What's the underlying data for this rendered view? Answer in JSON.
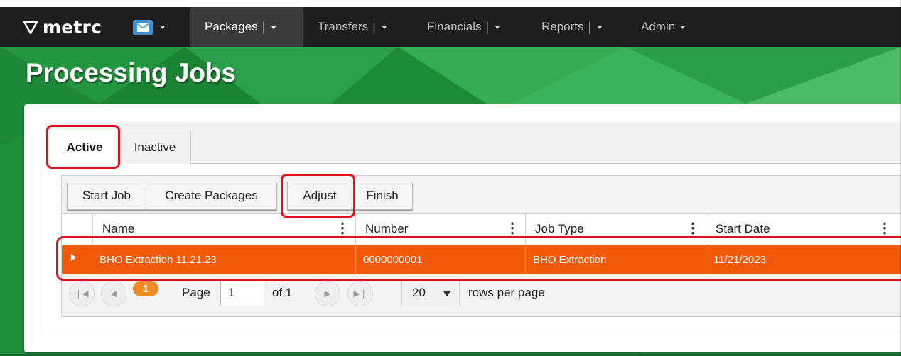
{
  "app": {
    "logo_text": "metrc"
  },
  "nav": {
    "items": [
      {
        "label": "Packages",
        "active": true
      },
      {
        "label": "Transfers",
        "active": false
      },
      {
        "label": "Financials",
        "active": false
      },
      {
        "label": "Reports",
        "active": false
      },
      {
        "label": "Admin",
        "active": false
      }
    ]
  },
  "page": {
    "title": "Processing Jobs"
  },
  "tabs": [
    {
      "label": "Active",
      "selected": true
    },
    {
      "label": "Inactive",
      "selected": false
    }
  ],
  "toolbar": {
    "start_job": "Start Job",
    "create_packages": "Create Packages",
    "adjust": "Adjust",
    "finish": "Finish"
  },
  "grid": {
    "columns": [
      "Name",
      "Number",
      "Job Type",
      "Start Date"
    ],
    "rows": [
      {
        "name": "BHO Extraction 11.21.23",
        "number": "0000000001",
        "job_type": "BHO Extraction",
        "start_date": "11/21/2023"
      }
    ]
  },
  "pager": {
    "current_page_badge": "1",
    "page_label": "Page",
    "page_value": "1",
    "of_label": "of 1",
    "rows_value": "20",
    "rows_label": "rows per page"
  },
  "colors": {
    "navbar": "#1e1e1e",
    "banner_green": "#1f8f3c",
    "selected_row": "#f25a0c",
    "highlight": "#e0101d",
    "page_badge": "#f28b23"
  }
}
